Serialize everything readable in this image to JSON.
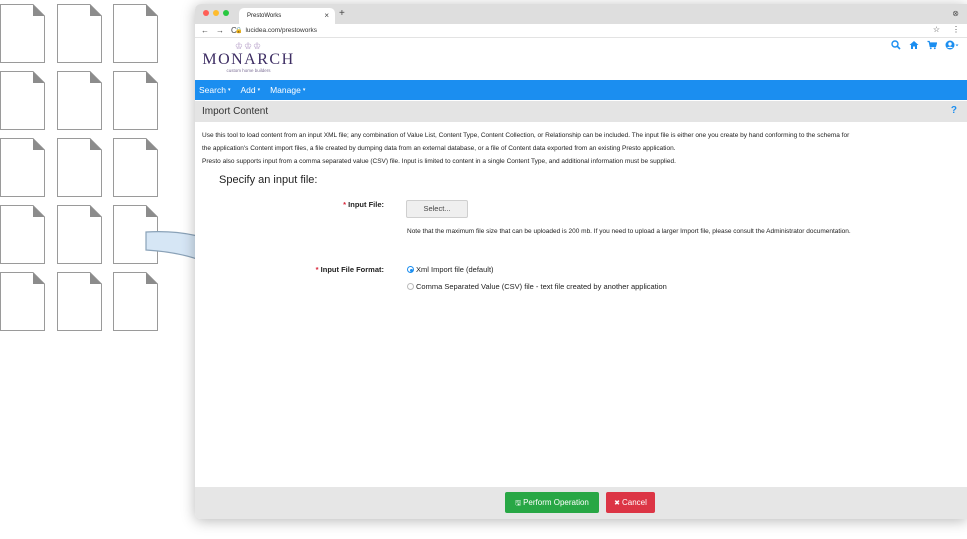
{
  "browser": {
    "tab_title": "PrestoWorks",
    "tab_close": "×",
    "new_tab": "+",
    "url": "lucidea.com/prestoworks",
    "nav_back": "←",
    "nav_forward": "→",
    "nav_reload": "C",
    "star": "☆",
    "more": "⋮",
    "window_control": "⊗",
    "dot_colors": [
      "#ff5f57",
      "#febc2e",
      "#28c840"
    ]
  },
  "logo": {
    "crown": "♔♔♔",
    "brand": "MONARCH",
    "tagline": "custom home builders"
  },
  "header_icons": [
    "search-icon",
    "home-icon",
    "cart-icon",
    "user-icon"
  ],
  "menu": [
    {
      "label": "Search",
      "caret": "▾"
    },
    {
      "label": "Add",
      "caret": "▾"
    },
    {
      "label": "Manage",
      "caret": "▾"
    }
  ],
  "page": {
    "title": "Import Content",
    "help": "?",
    "description": [
      "Use this tool to load content from an input XML file; any combination of Value List, Content Type, Content Collection, or Relationship can be included. The input file is either one you create by hand conforming to the schema for",
      "the application's Content import files, a file created by dumping data from an external database, or a file of Content data exported from an existing Presto application.",
      "Presto also supports input from a comma separated value (CSV) file. Input is limited to content in a single Content Type, and additional information must be supplied."
    ],
    "section_title": "Specify an input file:",
    "input_file": {
      "required_mark": "*",
      "label": "Input File:",
      "button": "Select...",
      "note": "Note that the maximum file size that can be uploaded is 200 mb. If you need to upload a larger Import file, please consult the Administrator documentation."
    },
    "format": {
      "required_mark": "*",
      "label": "Input File Format:",
      "options": [
        {
          "label": "Xml Import file (default)",
          "selected": true
        },
        {
          "label": "Comma Separated Value (CSV) file - text file created by another application",
          "selected": false
        }
      ]
    }
  },
  "footer": {
    "perform_icon": "🖫",
    "perform": "Perform Operation",
    "cancel_icon": "✖",
    "cancel": "Cancel"
  },
  "colors": {
    "menu_bar": "#1b8ef0",
    "brand": "#3d2d63",
    "perform": "#28a745",
    "cancel": "#dc3545"
  }
}
